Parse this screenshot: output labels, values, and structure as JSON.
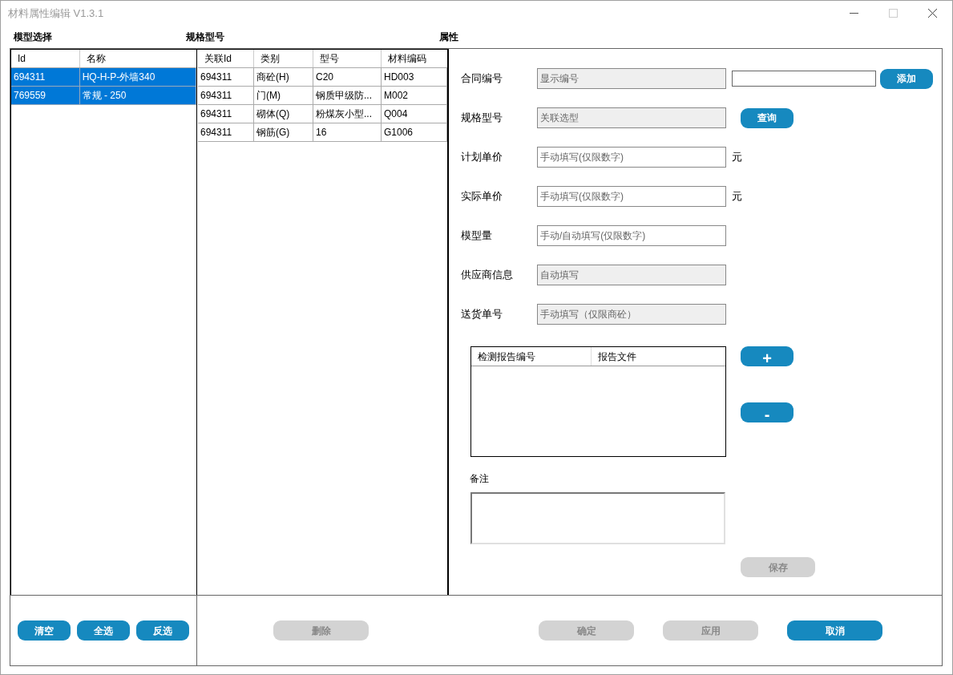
{
  "window": {
    "title": "材料属性编辑 V1.3.1"
  },
  "model_panel": {
    "title": "模型选择",
    "columns": [
      "Id",
      "名称"
    ],
    "rows": [
      {
        "cells": [
          "694311",
          "HQ-H-P-外墙340"
        ],
        "selected": true
      },
      {
        "cells": [
          "769559",
          "常规 - 250"
        ],
        "selected": true
      }
    ],
    "buttons": [
      {
        "label": "清空",
        "disabled": false
      },
      {
        "label": "全选",
        "disabled": false
      },
      {
        "label": "反选",
        "disabled": false
      }
    ]
  },
  "spec_panel": {
    "title": "规格型号",
    "columns": [
      "关联Id",
      "类别",
      "型号",
      "材料编码"
    ],
    "rows": [
      {
        "cells": [
          "694311",
          "商砼(H)",
          "C20",
          "HD003"
        ],
        "selected": false
      },
      {
        "cells": [
          "694311",
          "门(M)",
          "钢质甲级防...",
          "M002"
        ],
        "selected": false
      },
      {
        "cells": [
          "694311",
          "砌体(Q)",
          "粉煤灰小型...",
          "Q004"
        ],
        "selected": false
      },
      {
        "cells": [
          "694311",
          "钢筋(G)",
          "16",
          "G1006"
        ],
        "selected": false
      }
    ],
    "buttons": [
      {
        "label": "删除",
        "disabled": true
      }
    ]
  },
  "properties": {
    "title": "属性",
    "fields": [
      {
        "label": "合同编号",
        "placeholder": "显示编号",
        "disabled": true,
        "extra_input": true,
        "button": {
          "label": "添加",
          "disabled": false
        }
      },
      {
        "label": "规格型号",
        "placeholder": "关联选型",
        "disabled": true,
        "button": {
          "label": "查询",
          "disabled": false
        }
      },
      {
        "label": "计划单价",
        "placeholder": "手动填写(仅限数字)",
        "disabled": false,
        "unit": "元"
      },
      {
        "label": "实际单价",
        "placeholder": "手动填写(仅限数字)",
        "disabled": false,
        "unit": "元"
      },
      {
        "label": "模型量",
        "placeholder": "手动/自动填写(仅限数字)",
        "disabled": false
      },
      {
        "label": "供应商信息",
        "placeholder": "自动填写",
        "disabled": true
      },
      {
        "label": "送货单号",
        "placeholder": "手动填写（仅限商砼）",
        "disabled": true
      }
    ],
    "report_table": {
      "columns": [
        "检测报告编号",
        "报告文件"
      ]
    },
    "report_buttons": [
      {
        "label": "+",
        "disabled": false
      },
      {
        "label": "-",
        "disabled": false
      }
    ],
    "remark": {
      "label": "备注"
    },
    "save_button": {
      "label": "保存",
      "disabled": true
    }
  },
  "footer_buttons": [
    {
      "label": "确定",
      "disabled": true
    },
    {
      "label": "应用",
      "disabled": true
    },
    {
      "label": "取消",
      "disabled": false
    }
  ]
}
